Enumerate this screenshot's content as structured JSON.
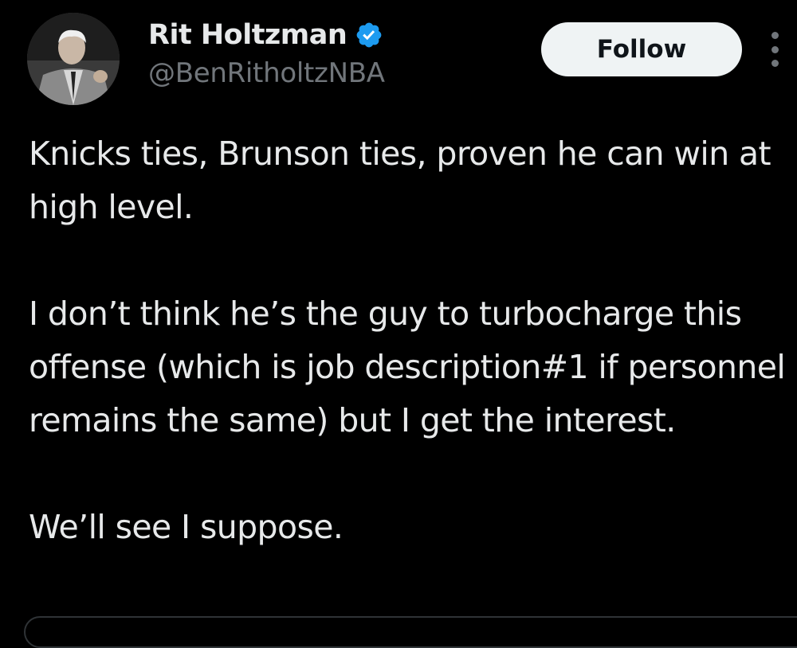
{
  "author": {
    "display_name": "Rit Holtzman",
    "handle": "@BenRitholtzNBA",
    "verified": true,
    "avatar_icon": "profile-photo-man-in-suit"
  },
  "actions": {
    "follow_label": "Follow",
    "more_icon": "more-vertical-icon"
  },
  "tweet": {
    "paragraphs": [
      "Knicks ties, Brunson ties, proven he can win at high level.",
      "I don’t think he’s the guy to turbocharge this offense (which is job description#1 if personnel remains the same) but I get the interest.",
      "We’ll see I suppose."
    ]
  },
  "colors": {
    "background": "#000000",
    "text_primary": "#e7e9ea",
    "text_secondary": "#71767b",
    "verified_badge": "#1d9bf0",
    "follow_button_bg": "#eff3f4",
    "follow_button_text": "#0f1419"
  }
}
